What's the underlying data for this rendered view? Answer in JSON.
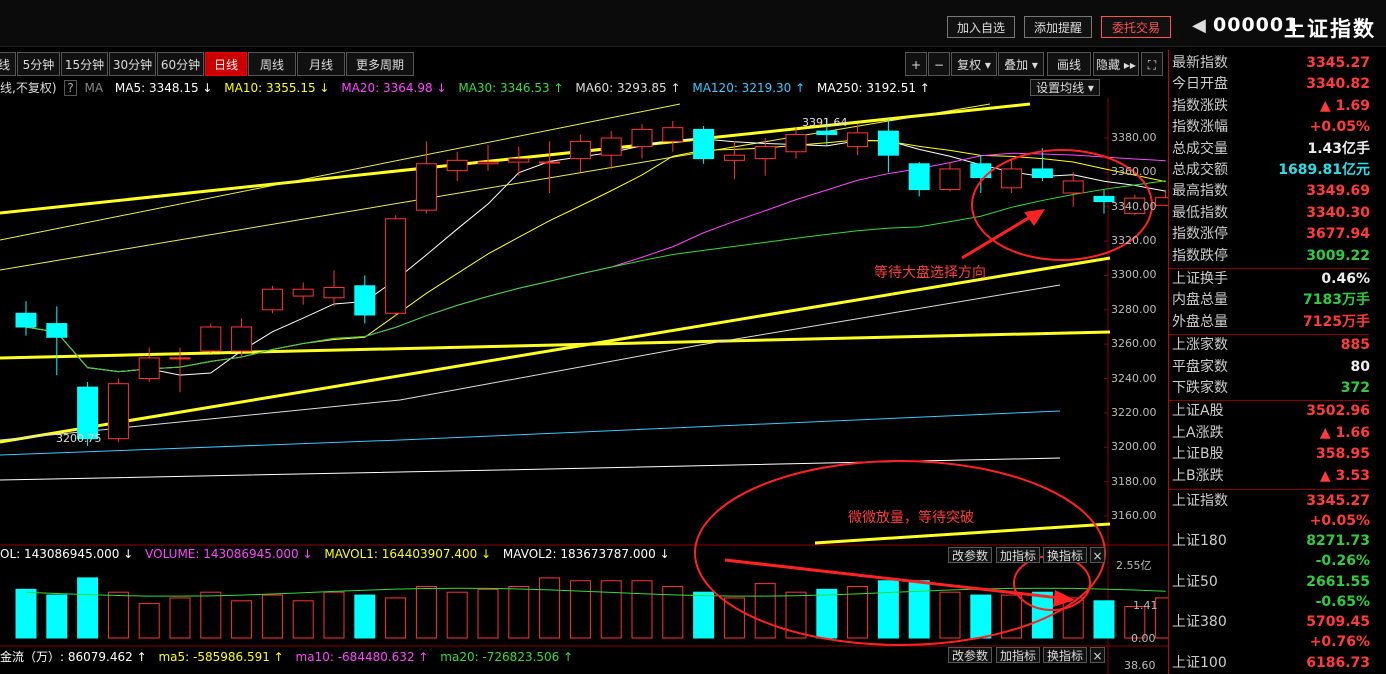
{
  "header": {
    "buttons": [
      "加入自选",
      "添加提醒",
      "委托交易"
    ],
    "code": "000001",
    "name": "上证指数"
  },
  "periods": [
    "5分钟",
    "15分钟",
    "30分钟",
    "60分钟",
    "日线",
    "周线",
    "月线",
    "更多周期"
  ],
  "active_period": "日线",
  "left_cut_label": "线",
  "chart_tools": [
    "+",
    "−",
    "复权",
    "叠加",
    "画线",
    "隐藏"
  ],
  "ma_legend": {
    "prefix": "线,不复权)",
    "help": "?",
    "ma": "MA",
    "items": [
      {
        "label": "MA5: 3348.15 ↓",
        "color": "#ffffff"
      },
      {
        "label": "MA10: 3355.15 ↓",
        "color": "#ffff00"
      },
      {
        "label": "MA20: 3364.98 ↓",
        "color": "#ff44ff"
      },
      {
        "label": "MA30: 3346.53 ↑",
        "color": "#33dd33"
      },
      {
        "label": "MA60: 3293.85 ↑",
        "color": "#dddddd"
      },
      {
        "label": "MA120: 3219.30 ↑",
        "color": "#33ccff"
      },
      {
        "label": "MA250: 3192.51 ↑",
        "color": "#ffffff"
      }
    ],
    "set_label": "设置均线"
  },
  "price_axis": [
    "3380.00",
    "3360.00",
    "3340.00",
    "3320.00",
    "3300.00",
    "3280.00",
    "3260.00",
    "3240.00",
    "3220.00",
    "3200.00",
    "3180.00",
    "3160.00"
  ],
  "high_marker": "3391.64",
  "low_marker": "3200.75",
  "volume_legend": {
    "items": [
      {
        "label": "OL: 143086945.000 ↓",
        "color": "#ffffff"
      },
      {
        "label": "VOLUME: 143086945.000 ↓",
        "color": "#ff44ff"
      },
      {
        "label": "MAVOL1: 164403907.400 ↓",
        "color": "#ffff00"
      },
      {
        "label": "MAVOL2: 183673787.000 ↓",
        "color": "#ffffff"
      }
    ]
  },
  "volume_axis": [
    "2.55亿",
    "1.41",
    "0.00"
  ],
  "flow_legend": {
    "items": [
      {
        "label": "金流（万）: 86079.462 ↑",
        "color": "#ffffff"
      },
      {
        "label": "ma5: -585986.591 ↑",
        "color": "#ffff00"
      },
      {
        "label": "ma10: -684480.632 ↑",
        "color": "#ff44ff"
      },
      {
        "label": "ma20: -726823.506 ↑",
        "color": "#33dd33"
      }
    ]
  },
  "flow_axis": "38.60",
  "sub_buttons": [
    "改参数",
    "加指标",
    "换指标",
    "×"
  ],
  "annotations": [
    "等待大盘选择方向",
    "微微放量，等待突破"
  ],
  "panel": {
    "rows": [
      {
        "k": "最新指数",
        "v": "3345.27",
        "c": "red"
      },
      {
        "k": "今日开盘",
        "v": "3340.82",
        "c": "red"
      },
      {
        "k": "指数涨跌",
        "v": "▲ 1.69",
        "c": "red"
      },
      {
        "k": "指数涨幅",
        "v": "+0.05%",
        "c": "red"
      },
      {
        "k": "总成交量",
        "v": "1.43亿手",
        "c": "white"
      },
      {
        "k": "总成交额",
        "v": "1689.81亿元",
        "c": "cyan"
      },
      {
        "k": "最高指数",
        "v": "3349.69",
        "c": "red"
      },
      {
        "k": "最低指数",
        "v": "3340.30",
        "c": "red"
      },
      {
        "k": "指数涨停",
        "v": "3677.94",
        "c": "red"
      },
      {
        "k": "指数跌停",
        "v": "3009.22",
        "c": "green"
      },
      {
        "k": "上证换手",
        "v": "0.46%",
        "c": "white"
      },
      {
        "k": "内盘总量",
        "v": "7183万手",
        "c": "green"
      },
      {
        "k": "外盘总量",
        "v": "7125万手",
        "c": "red"
      },
      {
        "k": "上涨家数",
        "v": "885",
        "c": "red"
      },
      {
        "k": "平盘家数",
        "v": "80",
        "c": "white"
      },
      {
        "k": "下跌家数",
        "v": "372",
        "c": "green"
      },
      {
        "k": "上证A股",
        "v": "3502.96",
        "c": "red"
      },
      {
        "k": "上A涨跌",
        "v": "▲ 1.66",
        "c": "red"
      },
      {
        "k": "上证B股",
        "v": "358.95",
        "c": "red"
      },
      {
        "k": "上B涨跌",
        "v": "▲ 3.53",
        "c": "red"
      }
    ],
    "indices": [
      {
        "k": "上证指数",
        "v": "3345.27",
        "p": "+0.05%",
        "c": "red"
      },
      {
        "k": "上证180",
        "v": "8271.73",
        "p": "-0.26%",
        "c": "green"
      },
      {
        "k": "上证50",
        "v": "2661.55",
        "p": "-0.65%",
        "c": "green"
      },
      {
        "k": "上证380",
        "v": "5709.45",
        "p": "+0.76%",
        "c": "red"
      },
      {
        "k": "上证100",
        "v": "6186.73",
        "p": "",
        "c": "red"
      }
    ]
  },
  "chart_data": {
    "type": "candlestick",
    "price_range": [
      3150,
      3400
    ],
    "candles": [
      {
        "o": 3278,
        "c": 3270,
        "h": 3285,
        "l": 3265
      },
      {
        "o": 3272,
        "c": 3264,
        "h": 3282,
        "l": 3242
      },
      {
        "o": 3235,
        "c": 3205,
        "h": 3238,
        "l": 3200.75
      },
      {
        "o": 3205,
        "c": 3237,
        "h": 3240,
        "l": 3203
      },
      {
        "o": 3240,
        "c": 3252,
        "h": 3258,
        "l": 3238
      },
      {
        "o": 3252,
        "c": 3252,
        "h": 3258,
        "l": 3232
      },
      {
        "o": 3256,
        "c": 3270,
        "h": 3272,
        "l": 3255
      },
      {
        "o": 3256,
        "c": 3270,
        "h": 3275,
        "l": 3253
      },
      {
        "o": 3280,
        "c": 3292,
        "h": 3294,
        "l": 3278
      },
      {
        "o": 3288,
        "c": 3292,
        "h": 3296,
        "l": 3283
      },
      {
        "o": 3287,
        "c": 3293,
        "h": 3303,
        "l": 3282
      },
      {
        "o": 3294,
        "c": 3277,
        "h": 3300,
        "l": 3272
      },
      {
        "o": 3278,
        "c": 3333,
        "h": 3335,
        "l": 3276
      },
      {
        "o": 3338,
        "c": 3365,
        "h": 3378,
        "l": 3336
      },
      {
        "o": 3361,
        "c": 3367,
        "h": 3372,
        "l": 3355
      },
      {
        "o": 3365,
        "c": 3366,
        "h": 3376,
        "l": 3361
      },
      {
        "o": 3366,
        "c": 3368,
        "h": 3375,
        "l": 3358
      },
      {
        "o": 3366,
        "c": 3366,
        "h": 3378,
        "l": 3348
      },
      {
        "o": 3368,
        "c": 3378,
        "h": 3382,
        "l": 3360
      },
      {
        "o": 3370,
        "c": 3380,
        "h": 3384,
        "l": 3362
      },
      {
        "o": 3375,
        "c": 3385,
        "h": 3388,
        "l": 3368
      },
      {
        "o": 3378,
        "c": 3386,
        "h": 3390,
        "l": 3372
      },
      {
        "o": 3385,
        "c": 3368,
        "h": 3387,
        "l": 3365
      },
      {
        "o": 3367,
        "c": 3370,
        "h": 3378,
        "l": 3356
      },
      {
        "o": 3368,
        "c": 3375,
        "h": 3380,
        "l": 3358
      },
      {
        "o": 3372,
        "c": 3382,
        "h": 3386,
        "l": 3368
      },
      {
        "o": 3384,
        "c": 3382,
        "h": 3391.64,
        "l": 3376
      },
      {
        "o": 3375,
        "c": 3383,
        "h": 3388,
        "l": 3370
      },
      {
        "o": 3384,
        "c": 3370,
        "h": 3391,
        "l": 3360
      },
      {
        "o": 3365,
        "c": 3350,
        "h": 3366,
        "l": 3346
      },
      {
        "o": 3350,
        "c": 3362,
        "h": 3366,
        "l": 3349
      },
      {
        "o": 3365,
        "c": 3357,
        "h": 3370,
        "l": 3348
      },
      {
        "o": 3351,
        "c": 3362,
        "h": 3367,
        "l": 3348
      },
      {
        "o": 3362,
        "c": 3357,
        "h": 3374,
        "l": 3355
      },
      {
        "o": 3348,
        "c": 3355,
        "h": 3360,
        "l": 3340
      },
      {
        "o": 3346,
        "c": 3343,
        "h": 3350,
        "l": 3336
      },
      {
        "o": 3336,
        "c": 3345,
        "h": 3347,
        "l": 3335
      },
      {
        "o": 3340.82,
        "c": 3345.27,
        "h": 3349.69,
        "l": 3340.3
      }
    ],
    "volume": [
      1.7,
      1.5,
      2.1,
      1.6,
      1.2,
      1.4,
      1.6,
      1.3,
      1.5,
      1.3,
      1.6,
      1.5,
      1.4,
      1.8,
      1.6,
      1.7,
      1.8,
      2.1,
      2.0,
      2.0,
      2.0,
      1.8,
      1.6,
      1.4,
      1.9,
      1.6,
      1.7,
      1.8,
      2.0,
      2.0,
      1.6,
      1.5,
      1.5,
      1.6,
      1.4,
      1.3,
      1.1,
      1.4
    ],
    "volume_range": [
      0,
      2.55
    ]
  }
}
